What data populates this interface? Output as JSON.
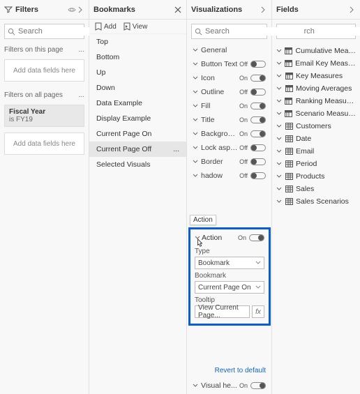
{
  "filters": {
    "title": "Filters",
    "search_placeholder": "Search",
    "section_page": "Filters on this page",
    "section_all": "Filters on all pages",
    "dropzone": "Add data fields here",
    "card": {
      "name": "Fiscal Year",
      "sub": "is FY19"
    }
  },
  "bookmarks": {
    "title": "Bookmarks",
    "add": "Add",
    "view": "View",
    "items": [
      "Top",
      "Bottom",
      "Up",
      "Down",
      "Data Example",
      "Display Example",
      "Current Page On",
      "Current Page Off",
      "Selected Visuals"
    ],
    "selected_index": 7
  },
  "viz": {
    "title": "Visualizations",
    "search_placeholder": "Search",
    "rows": [
      {
        "label": "General",
        "toggle": null
      },
      {
        "label": "Button Text",
        "toggle": "off"
      },
      {
        "label": "Icon",
        "toggle": "on"
      },
      {
        "label": "Outline",
        "toggle": "off"
      },
      {
        "label": "Fill",
        "toggle": "on"
      },
      {
        "label": "Title",
        "toggle": "on"
      },
      {
        "label": "Backgrou...",
        "toggle": "on"
      },
      {
        "label": "Lock aspe...",
        "toggle": "off"
      },
      {
        "label": "Border",
        "toggle": "off"
      },
      {
        "label": "hadow",
        "toggle": "off"
      }
    ],
    "hover_tag": "Action",
    "action": {
      "label": "Action",
      "toggle": "on",
      "type_label": "Type",
      "type_value": "Bookmark",
      "bookmark_label": "Bookmark",
      "bookmark_value": "Current Page On",
      "tooltip_label": "Tooltip",
      "tooltip_value": "View Current Page...",
      "fx": "fx"
    },
    "revert": "Revert to default",
    "visual_header": {
      "label": "Visual he...",
      "toggle": "on"
    }
  },
  "fields": {
    "title": "Fields",
    "search_placeholder": "Search",
    "items": [
      {
        "icon": "calc",
        "label": "Cumulative Meas..."
      },
      {
        "icon": "calc",
        "label": "Email Key Measur..."
      },
      {
        "icon": "calc",
        "label": "Key Measures"
      },
      {
        "icon": "calc",
        "label": "Moving Averages"
      },
      {
        "icon": "calc",
        "label": "Ranking Measures"
      },
      {
        "icon": "calc",
        "label": "Scenario Measures"
      },
      {
        "icon": "table",
        "label": "Customers"
      },
      {
        "icon": "table",
        "label": "Date"
      },
      {
        "icon": "table",
        "label": "Email"
      },
      {
        "icon": "table",
        "label": "Period"
      },
      {
        "icon": "table",
        "label": "Products"
      },
      {
        "icon": "table",
        "label": "Sales"
      },
      {
        "icon": "table",
        "label": "Sales Scenarios"
      }
    ]
  }
}
